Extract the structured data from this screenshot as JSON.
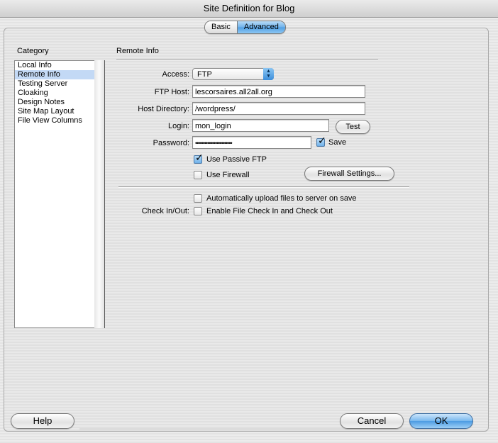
{
  "window": {
    "title": "Site Definition for Blog"
  },
  "tabs": [
    {
      "label": "Basic",
      "selected": false
    },
    {
      "label": "Advanced",
      "selected": true
    }
  ],
  "category": {
    "label": "Category",
    "items": [
      "Local Info",
      "Remote Info",
      "Testing Server",
      "Cloaking",
      "Design Notes",
      "Site Map Layout",
      "File View Columns"
    ],
    "selected": "Remote Info"
  },
  "remote": {
    "title": "Remote Info",
    "access_label": "Access:",
    "access_value": "FTP",
    "ftp_host_label": "FTP Host:",
    "ftp_host_value": "lescorsaires.all2all.org",
    "host_dir_label": "Host Directory:",
    "host_dir_value": "/wordpress/",
    "login_label": "Login:",
    "login_value": "mon_login",
    "test_button": "Test",
    "password_label": "Password:",
    "password_value": "••••••••••••••••••••••••",
    "save_label": "Save",
    "save_checked": true,
    "passive_ftp_label": "Use Passive FTP",
    "passive_ftp_checked": true,
    "firewall_label": "Use Firewall",
    "firewall_checked": false,
    "firewall_settings_button": "Firewall Settings...",
    "auto_upload_label": "Automatically upload files to server on save",
    "auto_upload_checked": false,
    "checkin_label": "Check In/Out:",
    "checkin_option_label": "Enable File Check In and Check Out",
    "checkin_checked": false
  },
  "buttons": {
    "help": "Help",
    "cancel": "Cancel",
    "ok": "OK"
  },
  "colors": {
    "selection": "#c3d9f5",
    "accent": "#4f9ee3"
  }
}
